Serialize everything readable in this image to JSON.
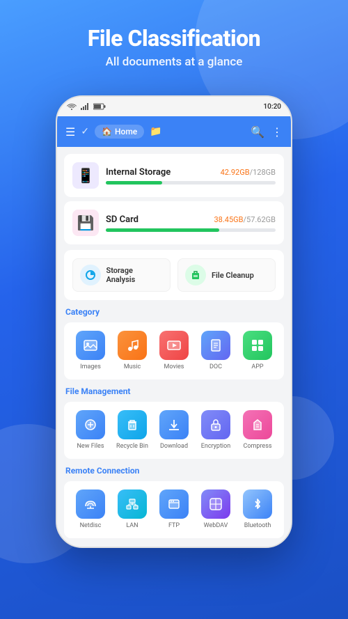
{
  "header": {
    "title": "File Classification",
    "subtitle": "All documents at a glance"
  },
  "statusBar": {
    "wifi": "📶",
    "signal": "📶",
    "battery": "🔋",
    "time": "10:20"
  },
  "appBar": {
    "homeLabel": "Home"
  },
  "storage": [
    {
      "id": "internal",
      "name": "Internal Storage",
      "usedGB": "42.92GB",
      "totalGB": "128GB",
      "fillPercent": 33,
      "icon": "📱"
    },
    {
      "id": "sdcard",
      "name": "SD Card",
      "usedGB": "38.45GB",
      "totalGB": "57.62GB",
      "fillPercent": 67,
      "icon": "💾"
    }
  ],
  "quickActions": [
    {
      "id": "storage-analysis",
      "label": "Storage Analysis",
      "icon": "🔵"
    },
    {
      "id": "file-cleanup",
      "label": "File Cleanup",
      "icon": "🟢"
    }
  ],
  "category": {
    "title": "Category",
    "items": [
      {
        "id": "images",
        "label": "Images",
        "icon": "🖼️",
        "iconClass": "icon-images"
      },
      {
        "id": "music",
        "label": "Music",
        "icon": "🎵",
        "iconClass": "icon-music"
      },
      {
        "id": "movies",
        "label": "Movies",
        "icon": "🎬",
        "iconClass": "icon-movies"
      },
      {
        "id": "doc",
        "label": "DOC",
        "icon": "📄",
        "iconClass": "icon-doc"
      },
      {
        "id": "app",
        "label": "APP",
        "icon": "📦",
        "iconClass": "icon-app"
      }
    ]
  },
  "fileManagement": {
    "title": "File Management",
    "items": [
      {
        "id": "new-files",
        "label": "New Files",
        "icon": "🕐",
        "iconClass": "icon-newfiles"
      },
      {
        "id": "recycle-bin",
        "label": "Recycle Bin",
        "icon": "🗑️",
        "iconClass": "icon-recycle"
      },
      {
        "id": "download",
        "label": "Download",
        "icon": "⬇️",
        "iconClass": "icon-download"
      },
      {
        "id": "encryption",
        "label": "Encryption",
        "icon": "🔒",
        "iconClass": "icon-encrypt"
      },
      {
        "id": "compress",
        "label": "Compress",
        "icon": "📦",
        "iconClass": "icon-compress"
      }
    ]
  },
  "remoteConnection": {
    "title": "Remote Connection",
    "items": [
      {
        "id": "netdisc",
        "label": "Netdisc",
        "icon": "☁️",
        "iconClass": "icon-netdisc"
      },
      {
        "id": "lan",
        "label": "LAN",
        "icon": "🖥️",
        "iconClass": "icon-lan"
      },
      {
        "id": "ftp",
        "label": "FTP",
        "icon": "📁",
        "iconClass": "icon-ftp"
      },
      {
        "id": "webdav",
        "label": "WebDAV",
        "icon": "🔲",
        "iconClass": "icon-webdav"
      },
      {
        "id": "bluetooth",
        "label": "Bluetooth",
        "icon": "📶",
        "iconClass": "icon-bluetooth"
      }
    ]
  }
}
